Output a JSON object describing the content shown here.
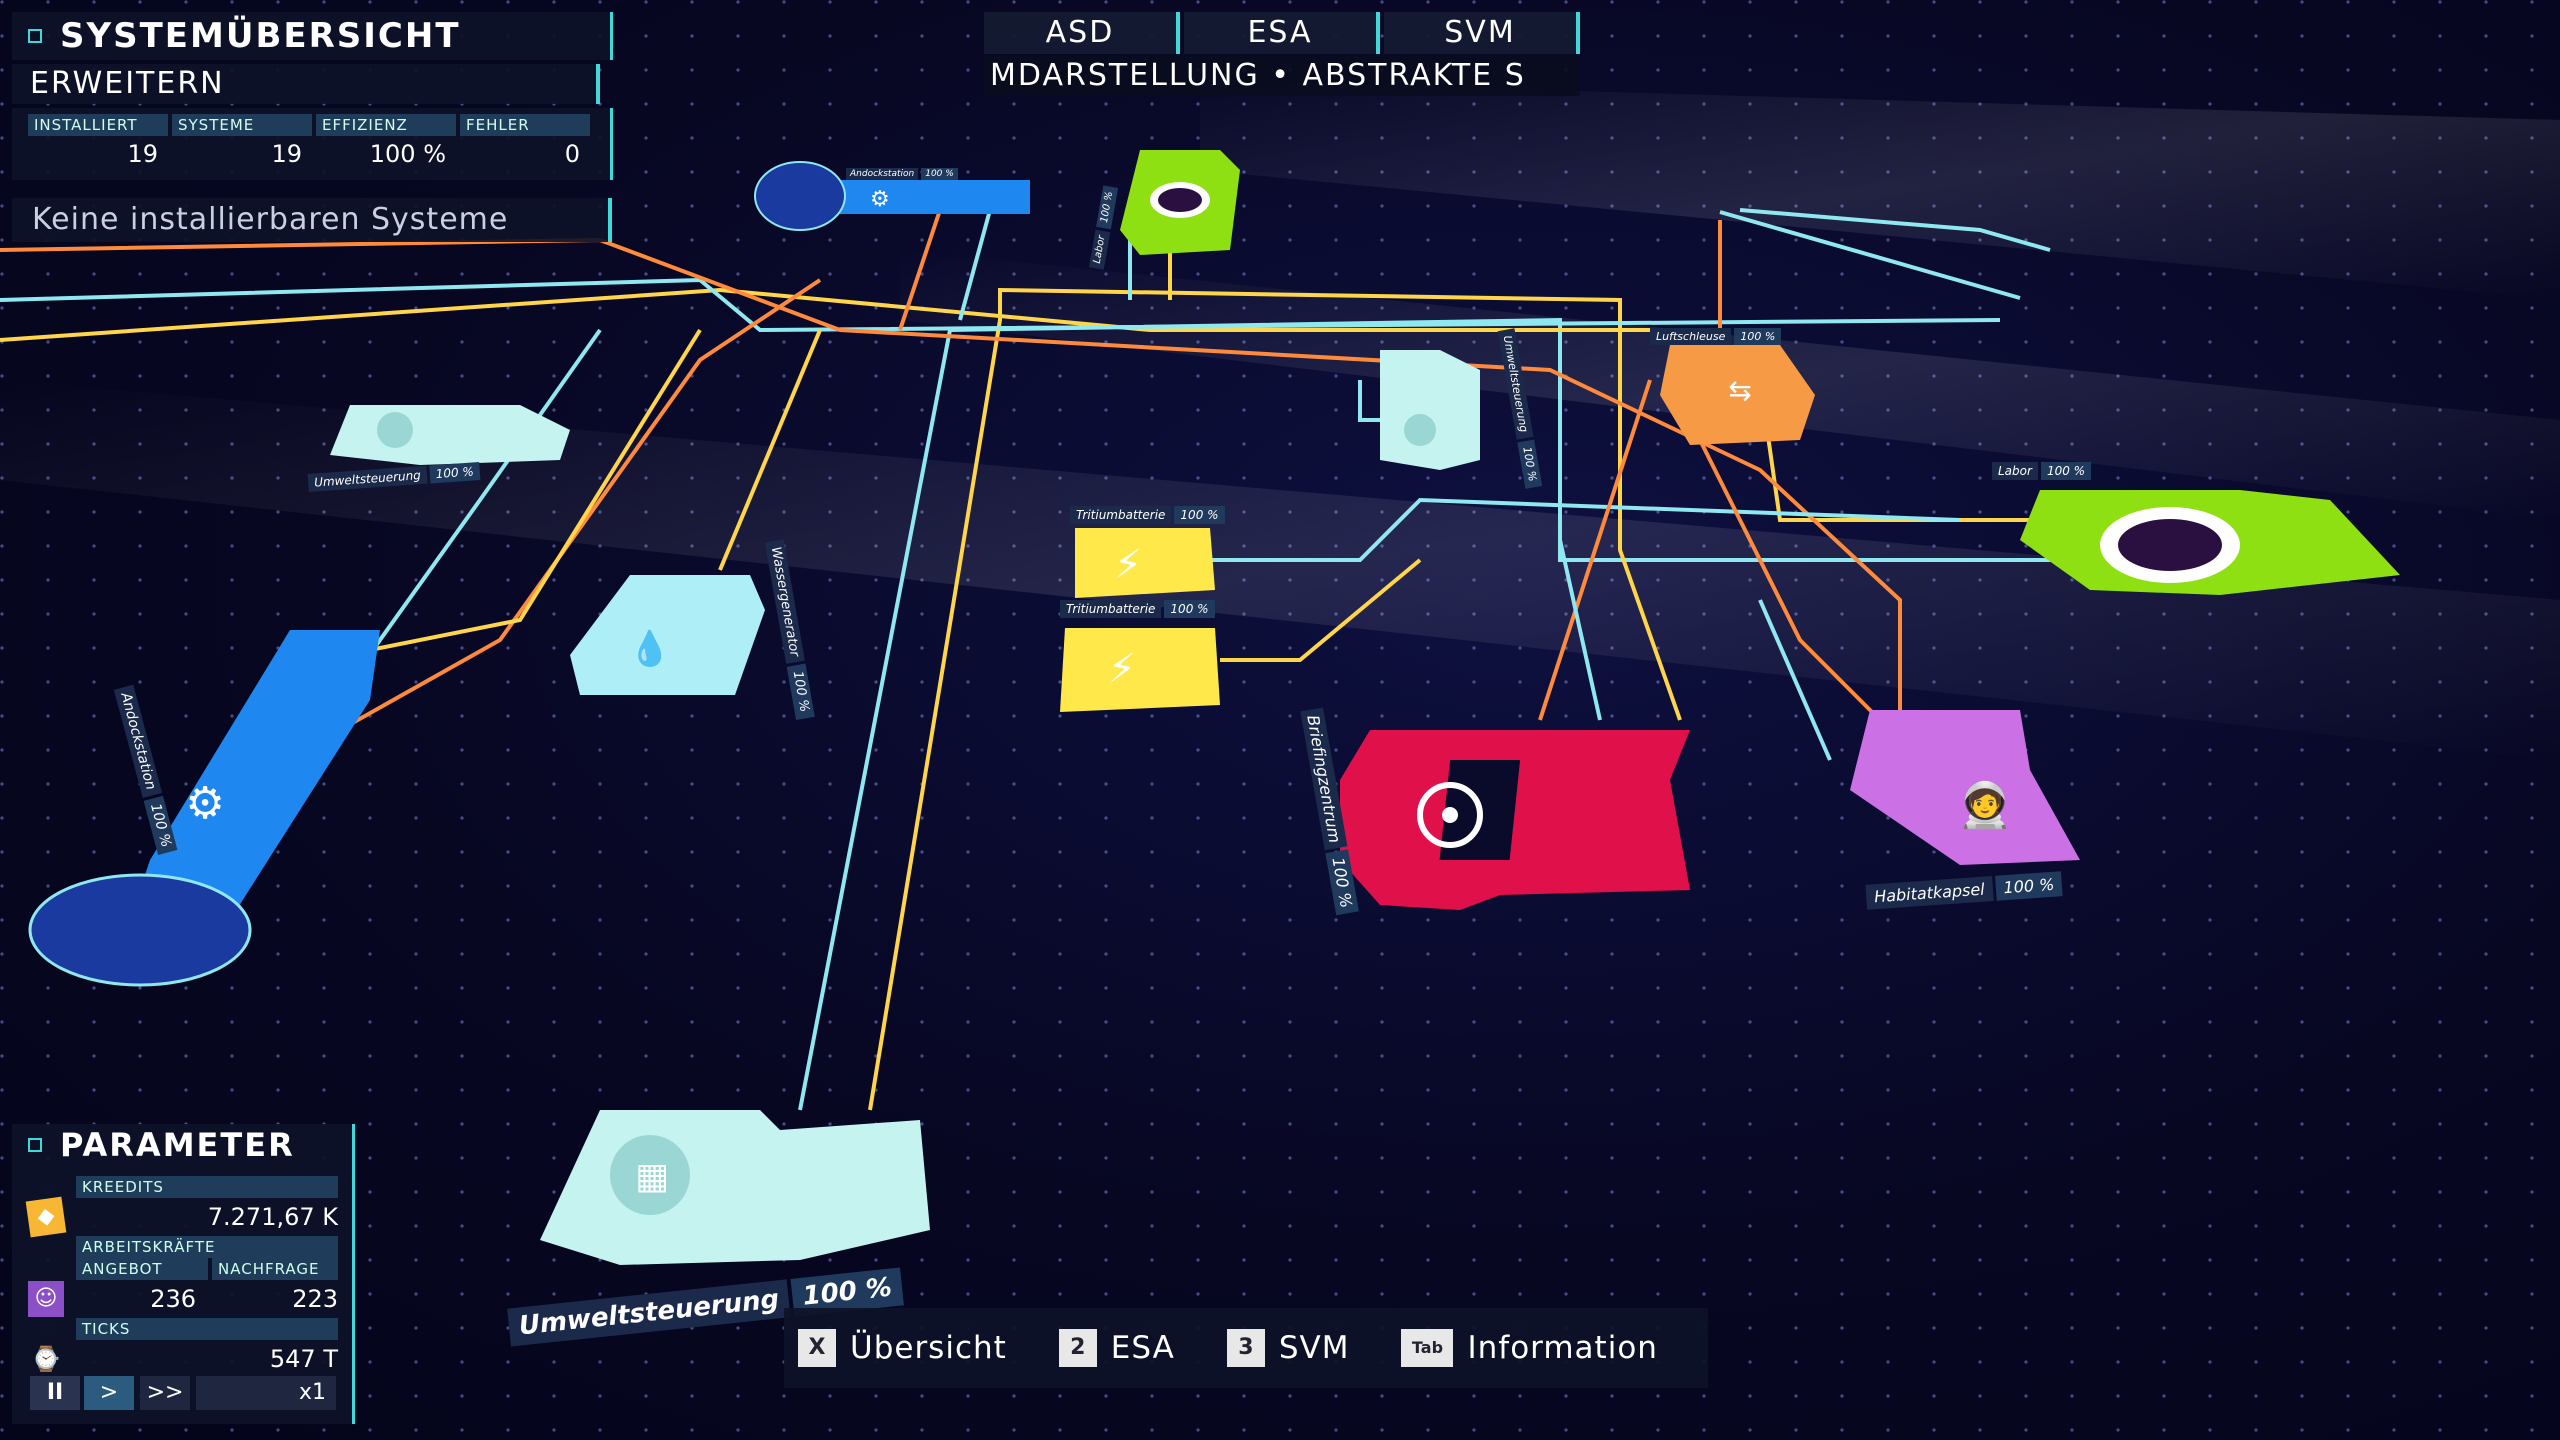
{
  "overview": {
    "title": "SYSTEMÜBERSICHT",
    "expand_label": "ERWEITERN",
    "stats": [
      {
        "label": "INSTALLIERT",
        "value": "19"
      },
      {
        "label": "SYSTEME",
        "value": "19"
      },
      {
        "label": "EFFIZIENZ",
        "value": "100 %"
      },
      {
        "label": "FEHLER",
        "value": "0"
      }
    ],
    "notice": "Keine installierbaren Systeme"
  },
  "tabs": [
    "ASD",
    "ESA",
    "SVM"
  ],
  "view_subtitle": "MDARSTELLUNG • ABSTRAKTE S",
  "parameters": {
    "title": "PARAMETER",
    "credits_label": "KREEDITS",
    "credits_value": "7.271,67 K",
    "workers_label": "ARBEITSKRÄFTE",
    "supply_label": "ANGEBOT",
    "demand_label": "NACHFRAGE",
    "supply_value": "236",
    "demand_value": "223",
    "ticks_label": "TICKS",
    "ticks_value": "547 T",
    "speed_multiplier": "x1"
  },
  "controls": {
    "pause": "II",
    "play": ">",
    "fast": ">>"
  },
  "shortcuts": [
    {
      "key": "X",
      "label": "Übersicht"
    },
    {
      "key": "2",
      "label": "ESA"
    },
    {
      "key": "3",
      "label": "SVM"
    },
    {
      "key": "Tab",
      "label": "Information"
    }
  ],
  "modules": [
    {
      "id": "umwelt_main",
      "label": "Umweltsteuerung",
      "pct": "100 %",
      "color": "#c5f3f0",
      "icon": "leaf-grid-icon"
    },
    {
      "id": "umwelt_left",
      "label": "Umweltsteuerung",
      "pct": "100 %",
      "color": "#c5f3f0",
      "icon": "leaf-grid-icon"
    },
    {
      "id": "umwelt_mid",
      "label": "Umweltsteuerung",
      "pct": "100 %",
      "color": "#c5f3f0",
      "icon": "leaf-grid-icon"
    },
    {
      "id": "tritium1",
      "label": "Tritiumbatterie",
      "pct": "100 %",
      "color": "#ffe94a",
      "icon": "lightning-icon"
    },
    {
      "id": "tritium2",
      "label": "Tritiumbatterie",
      "pct": "100 %",
      "color": "#ffe94a",
      "icon": "lightning-icon"
    },
    {
      "id": "wasser",
      "label": "Wassergenerator",
      "pct": "100 %",
      "color": "#aeeef6",
      "icon": "water-drop-icon"
    },
    {
      "id": "andock",
      "label": "Andockstation",
      "pct": "100 %",
      "color": "#1e88f0",
      "icon": "docking-icon"
    },
    {
      "id": "andock_top",
      "label": "Andockstation",
      "pct": "100 %",
      "color": "#1e88f0",
      "icon": "docking-icon"
    },
    {
      "id": "briefing",
      "label": "Briefingzentrum",
      "pct": "100 %",
      "color": "#e0104a",
      "icon": "target-icon"
    },
    {
      "id": "habitat",
      "label": "Habitatkapsel",
      "pct": "100 %",
      "color": "#cc70e6",
      "icon": "astronaut-icon"
    },
    {
      "id": "luftschleuse",
      "label": "Luftschleuse",
      "pct": "100 %",
      "color": "#f79a45",
      "icon": "airlock-icon"
    },
    {
      "id": "labor",
      "label": "Labor",
      "pct": "100 %",
      "color": "#8fe012",
      "icon": "lab-icon"
    },
    {
      "id": "labor_top",
      "label": "Labor",
      "pct": "100 %",
      "color": "#8fe012",
      "icon": "lab-icon"
    }
  ],
  "colors": {
    "accent": "#3fd9d9",
    "yellow_line": "#ffd54a",
    "orange_line": "#ff8a3c",
    "cyan_line": "#8fe8f0"
  }
}
